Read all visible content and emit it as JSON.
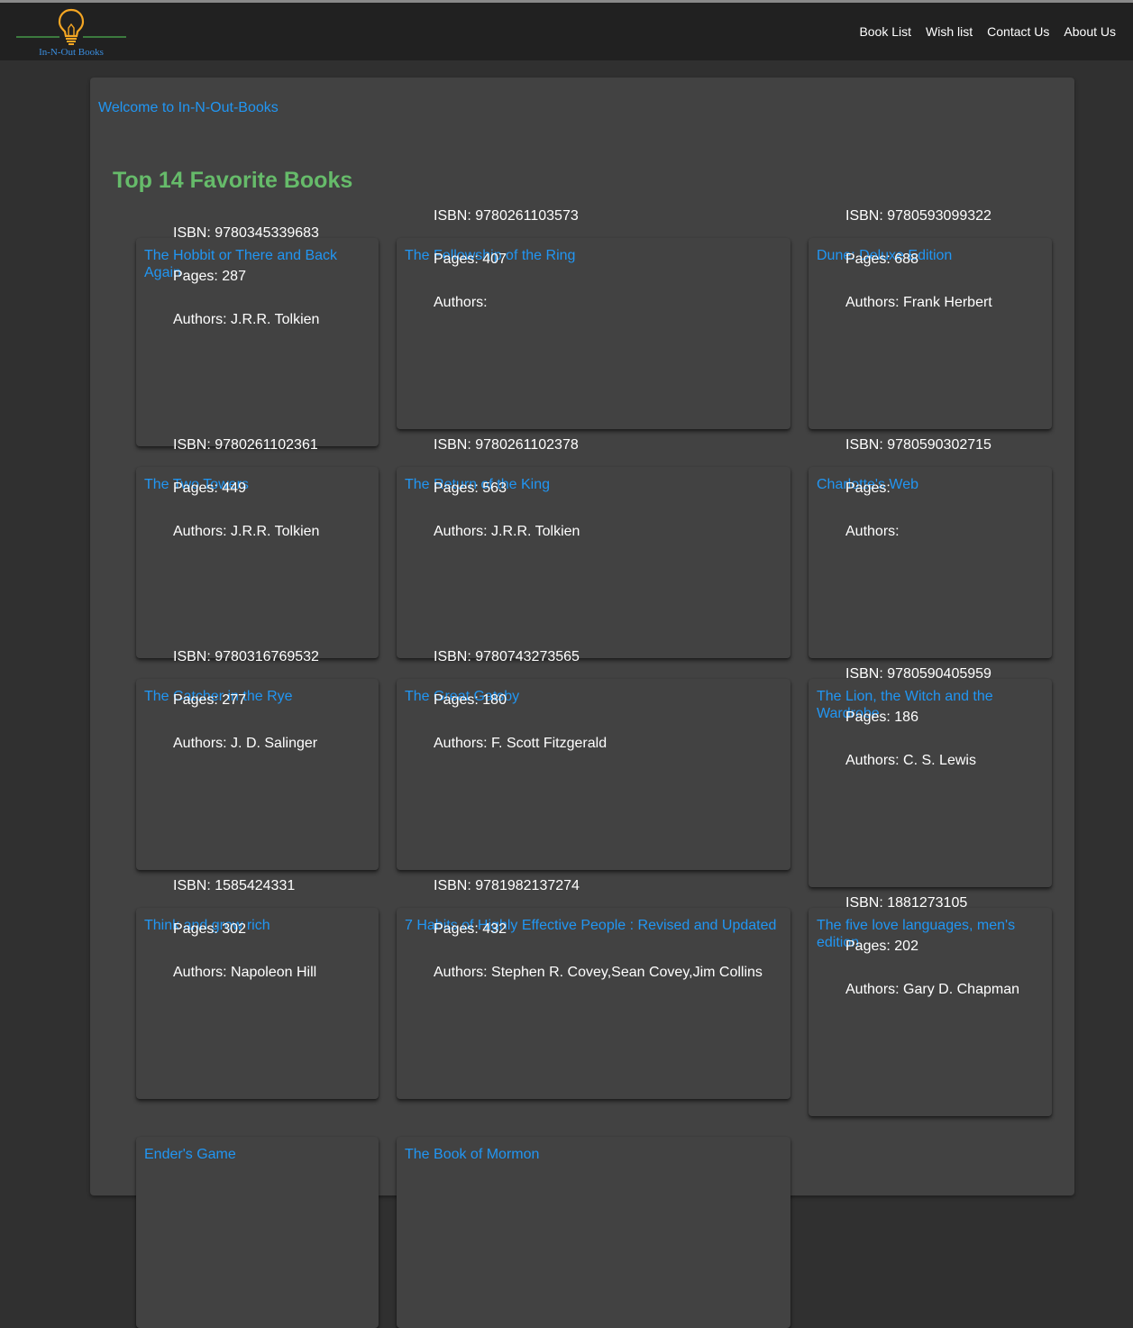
{
  "brand": {
    "logo_text": "In-N-Out Books"
  },
  "nav": {
    "items": [
      "Book List",
      "Wish list",
      "Contact Us",
      "About Us"
    ]
  },
  "welcome": "Welcome to In-N-Out-Books",
  "page_title": "Top 14 Favorite Books",
  "labels": {
    "isbn": "ISBN:",
    "pages": "Pages:",
    "authors": "Authors:"
  },
  "books": [
    {
      "title": "The Hobbit or There and Back Again",
      "isbn": "9780345339683",
      "pages": "287",
      "authors": "J.R.R. Tolkien"
    },
    {
      "title": "The Fellowship of the Ring",
      "isbn": "9780261103573",
      "pages": "407",
      "authors": ""
    },
    {
      "title": "Dune: Deluxe Edition",
      "isbn": "9780593099322",
      "pages": "688",
      "authors": "Frank Herbert"
    },
    {
      "title": "The Two Towers",
      "isbn": "9780261102361",
      "pages": "449",
      "authors": "J.R.R. Tolkien"
    },
    {
      "title": "The Return of the King",
      "isbn": "9780261102378",
      "pages": "563",
      "authors": "J.R.R. Tolkien"
    },
    {
      "title": "Charlotte's Web",
      "isbn": "9780590302715",
      "pages": "",
      "authors": ""
    },
    {
      "title": "The Catcher in the Rye",
      "isbn": "9780316769532",
      "pages": "277",
      "authors": "J. D. Salinger"
    },
    {
      "title": "The Great Gatsby",
      "isbn": "9780743273565",
      "pages": "180",
      "authors": "F. Scott Fitzgerald"
    },
    {
      "title": "The Lion, the Witch and the Wardrobe",
      "isbn": "9780590405959",
      "pages": "186",
      "authors": "C. S. Lewis"
    },
    {
      "title": "Think and grow rich",
      "isbn": "1585424331",
      "pages": "302",
      "authors": "Napoleon Hill"
    },
    {
      "title": "7 Habits of Highly Effective People : Revised and Updated",
      "isbn": "9781982137274",
      "pages": "432",
      "authors": "Stephen R. Covey,Sean Covey,Jim Collins"
    },
    {
      "title": "The five love languages, men's edition",
      "isbn": "1881273105",
      "pages": "202",
      "authors": "Gary D. Chapman"
    },
    {
      "title": "Ender's Game",
      "isbn": "",
      "pages": "",
      "authors": ""
    },
    {
      "title": "The Book of Mormon",
      "isbn": "",
      "pages": "",
      "authors": ""
    }
  ],
  "colors": {
    "background": "#303030",
    "toolbar": "#212121",
    "card": "#424242",
    "link": "#2196f3",
    "title_green": "#66bb6a",
    "logo_bulb": "#f5a623",
    "logo_line": "#4caf50"
  },
  "icons": {
    "logo": "lightbulb-icon"
  }
}
